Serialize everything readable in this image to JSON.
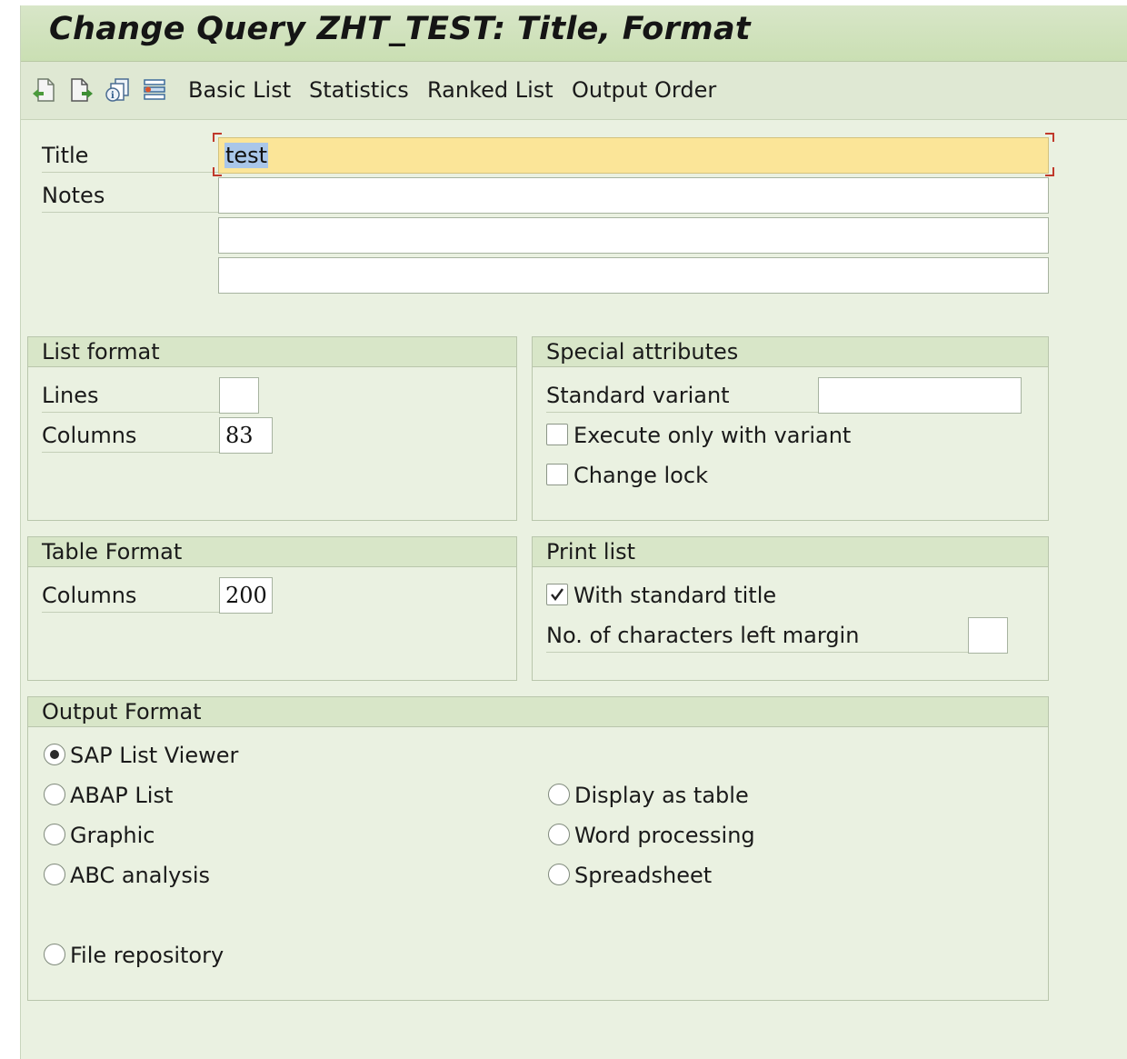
{
  "window": {
    "title": "Change Query ZHT_TEST: Title, Format"
  },
  "toolbar": {
    "icons": [
      "back-document-icon",
      "forward-document-icon",
      "copy-info-icon",
      "layout-icon"
    ],
    "buttons": [
      "Basic List",
      "Statistics",
      "Ranked List",
      "Output Order"
    ]
  },
  "header_form": {
    "title_label": "Title",
    "title_value": "test",
    "notes_label": "Notes",
    "notes_values": [
      "",
      "",
      ""
    ]
  },
  "list_format": {
    "heading": "List format",
    "lines_label": "Lines",
    "lines_value": "",
    "columns_label": "Columns",
    "columns_value": "83"
  },
  "special_attributes": {
    "heading": "Special attributes",
    "standard_variant_label": "Standard variant",
    "standard_variant_value": "",
    "execute_only_label": "Execute only with variant",
    "execute_only_checked": false,
    "change_lock_label": "Change lock",
    "change_lock_checked": false
  },
  "table_format": {
    "heading": "Table Format",
    "columns_label": "Columns",
    "columns_value": "200"
  },
  "print_list": {
    "heading": "Print list",
    "with_title_label": "With standard title",
    "with_title_checked": true,
    "left_margin_label": "No. of characters left margin",
    "left_margin_value": ""
  },
  "output_format": {
    "heading": "Output Format",
    "selected": "SAP List Viewer",
    "options": {
      "sap_list_viewer": "SAP List Viewer",
      "abap_list": "ABAP List",
      "graphic": "Graphic",
      "abc_analysis": "ABC analysis",
      "file_repository": "File repository",
      "display_as_table": "Display as table",
      "word_processing": "Word processing",
      "spreadsheet": "Spreadsheet"
    }
  },
  "colors": {
    "background": "#eaf1e1",
    "header": "#d8e6c8",
    "title_field": "#fbe598",
    "selection": "#a9c6e9",
    "focus_corner": "#c0392b"
  }
}
